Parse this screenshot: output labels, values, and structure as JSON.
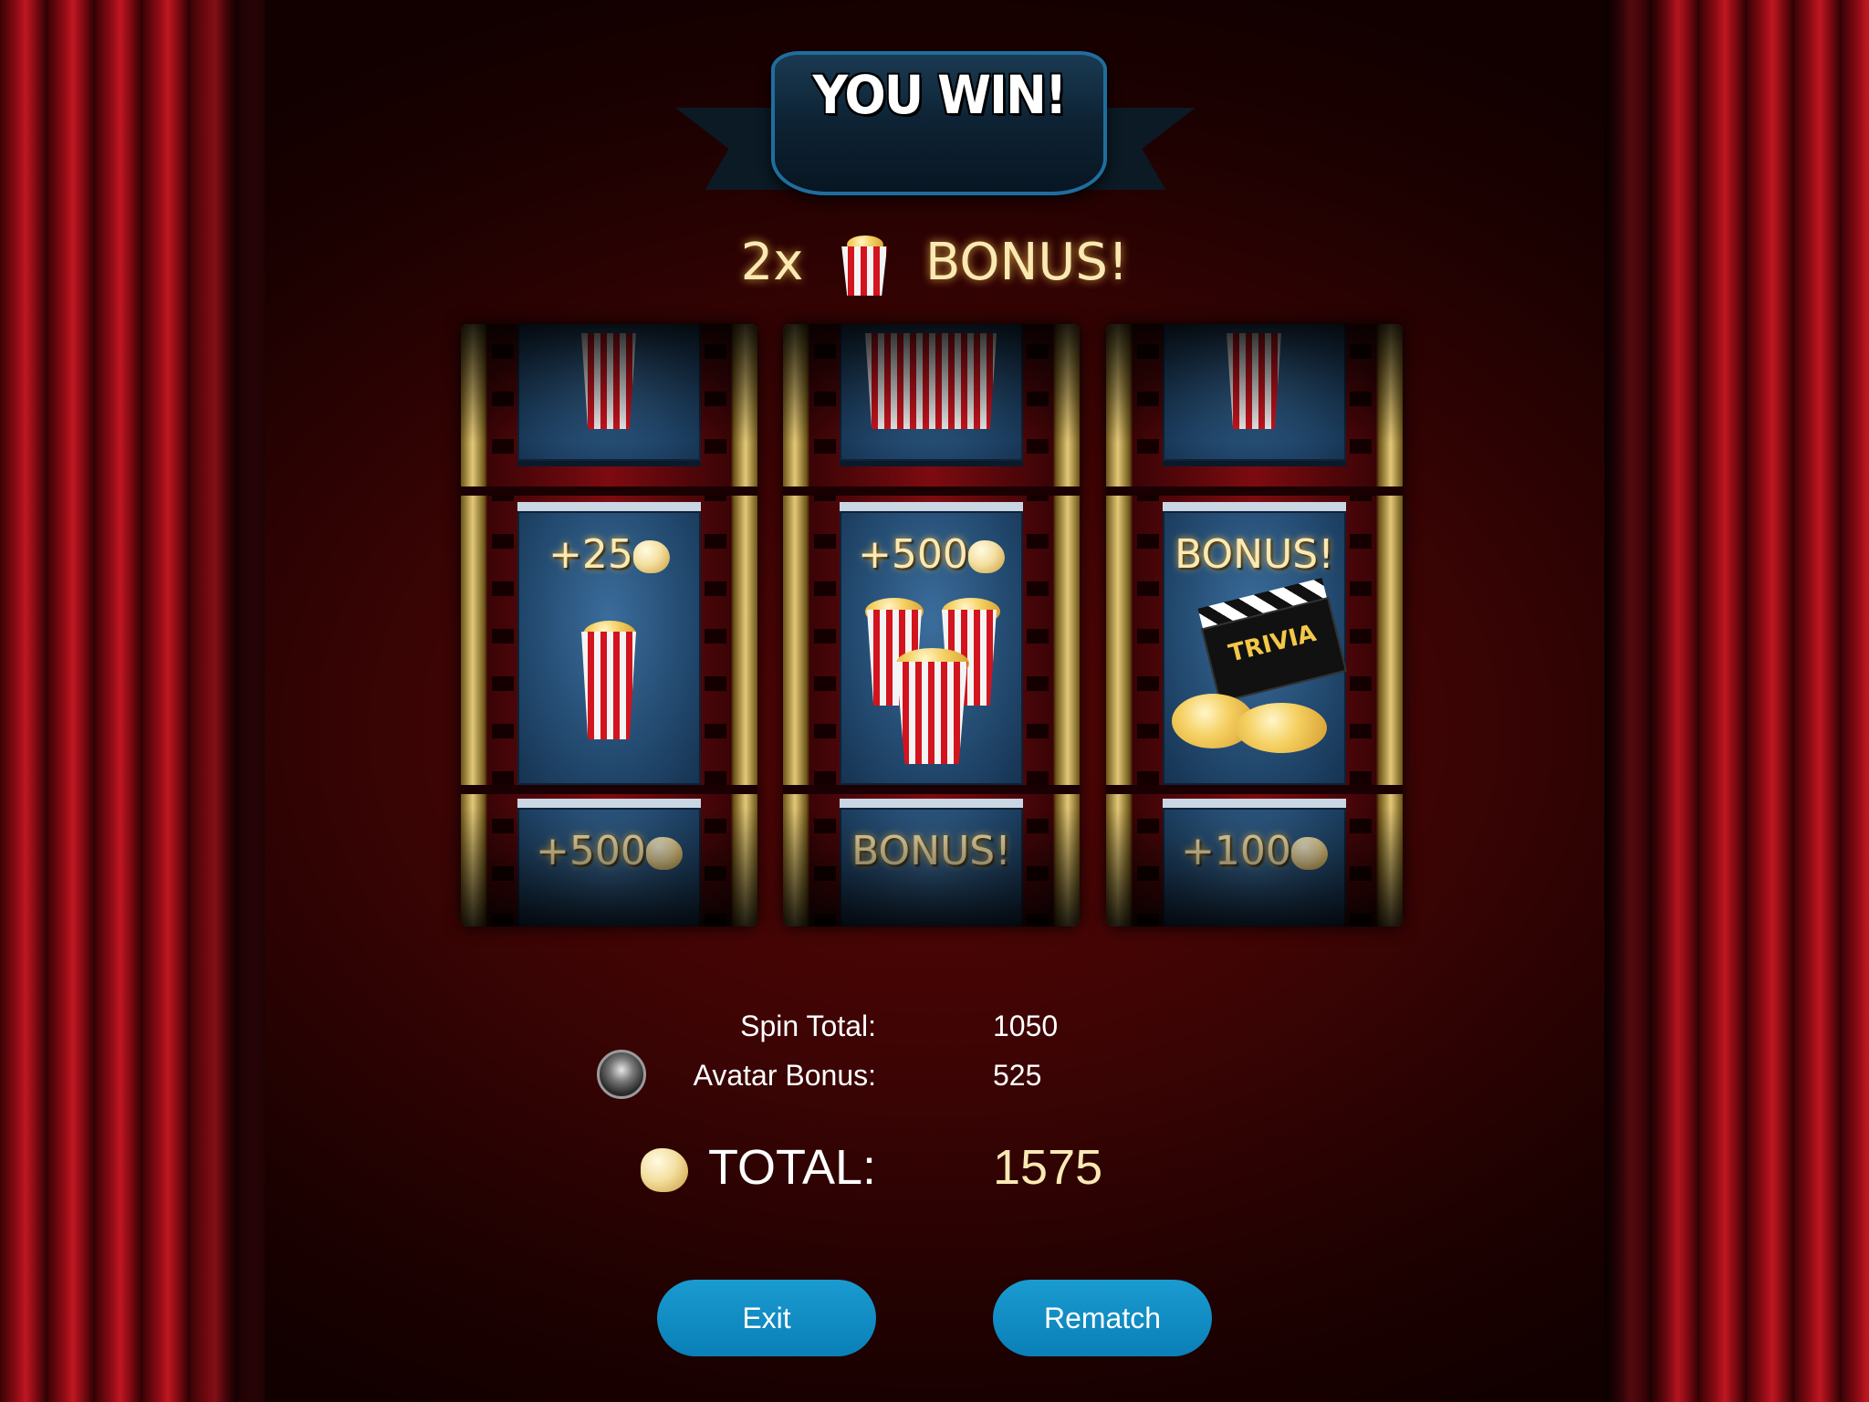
{
  "banner": {
    "title": "YOU WIN!"
  },
  "bonus": {
    "multiplier": "2x",
    "text": "BONUS!"
  },
  "reels": [
    {
      "top_label": "",
      "center_label": "+25",
      "bottom_label": "+500"
    },
    {
      "top_label": "",
      "center_label": "+500",
      "bottom_label": "BONUS!"
    },
    {
      "top_label": "",
      "center_label": "BONUS!",
      "center_badge": "TRIVIA",
      "bottom_label": "+100"
    }
  ],
  "score": {
    "spin_total_label": "Spin Total:",
    "spin_total_value": "1050",
    "avatar_bonus_label": "Avatar Bonus:",
    "avatar_bonus_value": "525",
    "total_label": "TOTAL:",
    "total_value": "1575"
  },
  "buttons": {
    "exit": "Exit",
    "rematch": "Rematch"
  },
  "colors": {
    "button": "#0a7fb8",
    "gold_text": "#fbe9b3",
    "curtain": "#c01722"
  },
  "icons": [
    "popcorn-cup-icon",
    "popcorn-kernel-icon",
    "clapperboard-icon",
    "avatar-icon"
  ]
}
